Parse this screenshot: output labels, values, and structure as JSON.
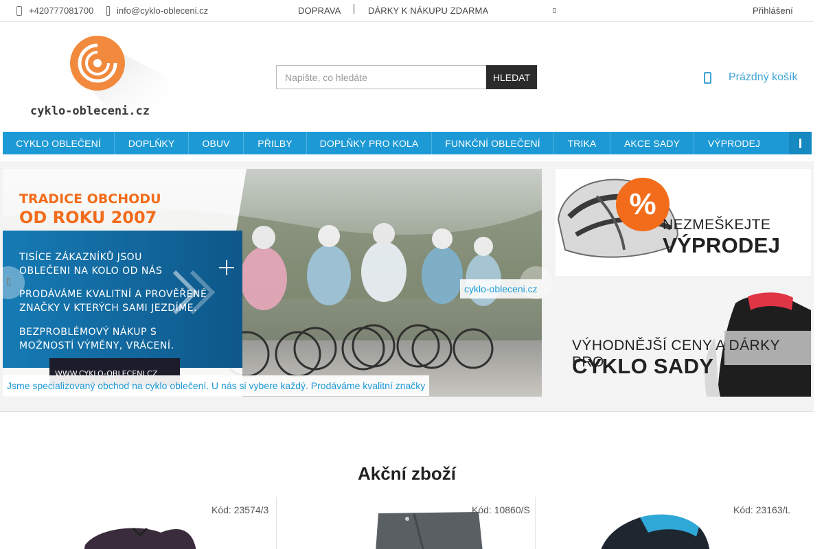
{
  "topbar": {
    "phone": "+420777081700",
    "email": "info@cyklo-obleceni.cz",
    "links": [
      "DOPRAVA",
      "DÁRKY K NÁKUPU ZDARMA"
    ],
    "login": "Přihlášení"
  },
  "header": {
    "logo_text": "cyklo-obleceni.cz",
    "search_placeholder": "Napište, co hledáte",
    "search_button": "HLEDAT",
    "cart_label": "Prázdný košík"
  },
  "nav": {
    "items": [
      "CYKLO OBLEČENÍ",
      "DOPLŇKY",
      "OBUV",
      "PŘILBY",
      "DOPLŇKY PRO KOLA",
      "FUNKČNÍ OBLEČENÍ",
      "TRIKA",
      "AKCE SADY",
      "VÝPRODEJ"
    ]
  },
  "slider": {
    "headline": [
      "TRADICE OBCHODU",
      "OD ROKU 2007"
    ],
    "lines": [
      "TISÍCE ZÁKAZNÍKŮ JSOU",
      "OBLEČENI NA KOLO OD NÁS",
      "PRODÁVÁME KVALITNÍ A PROVĚŘENÉ",
      "ZNAČKY V KTERÝCH SAMI JEZDÍME.",
      "BEZPROBLÉMOVÝ NÁKUP S",
      "MOŽNOSTÍ VÝMĚNY, VRÁCENÍ."
    ],
    "url_badge": "WWW.CYKLO-OBLECENI.CZ",
    "brand_caption": "cyklo-obleceni.cz",
    "caption": "Jsme specializovaný obchod na cyklo oblečení. U nás si vybere každý. Prodáváme kvalitní značky"
  },
  "banners": [
    {
      "small": "NEZMEŠKEJTE",
      "big": "VÝPRODEJ",
      "badge": "%"
    },
    {
      "small": "VÝHODNĚJŠÍ CENY A DÁRKY PRO",
      "big": "CYKLO SADY"
    }
  ],
  "section": {
    "title": "Akční zboží",
    "products": [
      {
        "code": "Kód: 23574/3"
      },
      {
        "code": "Kód: 10860/S"
      },
      {
        "code": "Kód: 23163/L"
      }
    ]
  },
  "colors": {
    "primary": "#1d9ad6",
    "accent": "#f26c1b",
    "dark": "#2b2b2b"
  }
}
